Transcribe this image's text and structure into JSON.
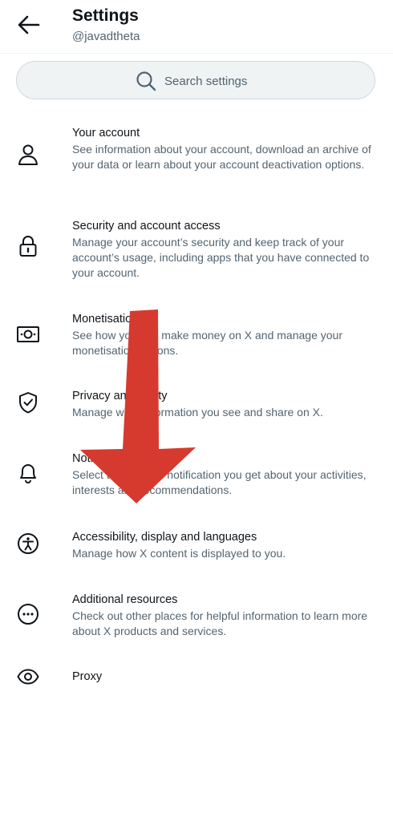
{
  "header": {
    "title": "Settings",
    "handle": "@javadtheta",
    "back_icon": "arrow-left-icon"
  },
  "search": {
    "placeholder": "Search settings",
    "icon": "search-icon"
  },
  "items": [
    {
      "icon": "person-icon",
      "title": "Your account",
      "description": "See information about your account, download an archive of your data or learn about your account deactivation options."
    },
    {
      "icon": "lock-icon",
      "title": "Security and account access",
      "description": "Manage your account’s security and keep track of your account’s usage, including apps that you have connected to your account."
    },
    {
      "icon": "money-icon",
      "title": "Monetisation",
      "description": "See how you can make money on X and manage your monetisation options."
    },
    {
      "icon": "shield-check-icon",
      "title": "Privacy and safety",
      "description": "Manage what information you see and share on X."
    },
    {
      "icon": "bell-icon",
      "title": "Notifications",
      "description": "Select the kinds of notification you get about your activities, interests and recommendations."
    },
    {
      "icon": "accessibility-icon",
      "title": "Accessibility, display and languages",
      "description": "Manage how X content is displayed to you."
    },
    {
      "icon": "more-circle-icon",
      "title": "Additional resources",
      "description": "Check out other places for helpful information to learn more about X products and services."
    },
    {
      "icon": "eye-icon",
      "title": "Proxy",
      "description": ""
    }
  ],
  "overlay": {
    "arrow_color": "#d63a2f",
    "arrow_icon": "red-down-arrow-annotation"
  }
}
